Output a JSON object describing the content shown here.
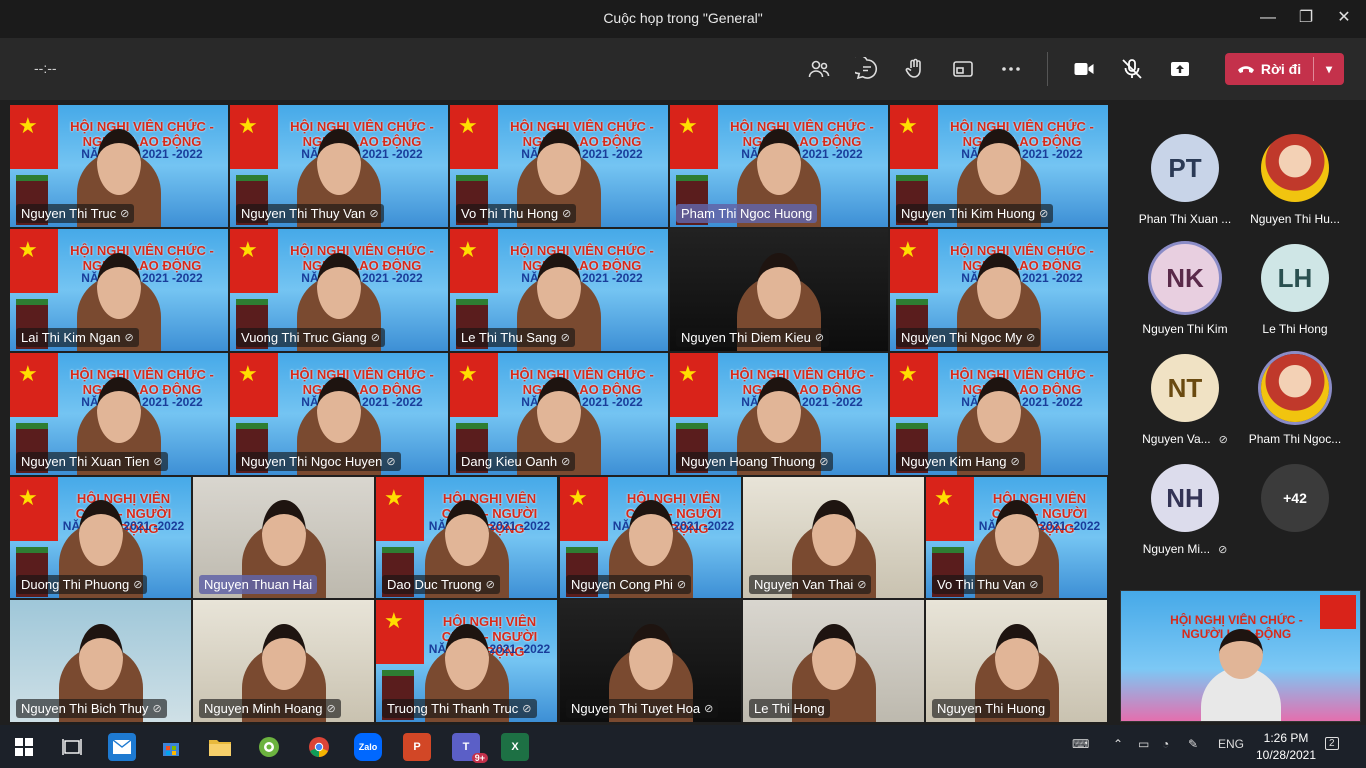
{
  "window": {
    "title": "Cuộc họp trong \"General\"",
    "minimize_icon": "minimize-icon",
    "maximize_icon": "maximize-icon",
    "close_icon": "close-icon"
  },
  "toolbar": {
    "timer": "--:--",
    "icons": [
      "participants-icon",
      "chat-icon",
      "reactions-icon",
      "rooms-icon",
      "more-icon",
      "camera-icon",
      "mic-muted-icon",
      "share-icon"
    ],
    "leave_label": "Rời đi",
    "leave_color": "#c4314b"
  },
  "banner_text": {
    "line1": "HỘI NGHỊ VIÊN CHỨC - NGƯỜI LAO ĐỘNG",
    "line2": "NĂM HỌC 2021 -2022"
  },
  "tiles": [
    {
      "name": "Nguyen Thi Truc",
      "muted": true
    },
    {
      "name": "Nguyen Thi Thuy Van",
      "muted": true
    },
    {
      "name": "Vo Thi Thu Hong",
      "muted": true
    },
    {
      "name": "Pham Thi Ngoc Huong",
      "muted": false,
      "speaking": true
    },
    {
      "name": "Nguyen Thi Kim Huong",
      "muted": true
    },
    {
      "name": "Lai Thi Kim Ngan",
      "muted": true
    },
    {
      "name": "Vuong Thi Truc Giang",
      "muted": true
    },
    {
      "name": "Le Thi Thu Sang",
      "muted": true
    },
    {
      "name": "Nguyen Thi Diem Kieu",
      "muted": true
    },
    {
      "name": "Nguyen Thi Ngoc My",
      "muted": true
    },
    {
      "name": "Nguyen Thi Xuan Tien",
      "muted": true
    },
    {
      "name": "Nguyen Thi Ngoc Huyen",
      "muted": true
    },
    {
      "name": "Dang Kieu Oanh",
      "muted": true
    },
    {
      "name": "Nguyen Hoang Thuong",
      "muted": true
    },
    {
      "name": "Nguyen Kim Hang",
      "muted": true
    },
    {
      "name": "Duong Thi Phuong",
      "muted": true
    },
    {
      "name": "Nguyen Thuan Hai",
      "muted": false,
      "speaking": true
    },
    {
      "name": "Dao Duc Truong",
      "muted": true
    },
    {
      "name": "Nguyen Cong Phi",
      "muted": true
    },
    {
      "name": "Nguyen Van Thai",
      "muted": true
    },
    {
      "name": "Vo Thi Thu Van",
      "muted": true
    },
    {
      "name": "Nguyen Thi Bich Thuy",
      "muted": true
    },
    {
      "name": "Nguyen Minh Hoang",
      "muted": true
    },
    {
      "name": "Truong Thi Thanh Truc",
      "muted": true
    },
    {
      "name": "Nguyen Thi Tuyet Hoa",
      "muted": true
    },
    {
      "name": "Le Thi Hong",
      "muted": false
    },
    {
      "name": "Nguyen Thi Huong",
      "muted": false
    }
  ],
  "sidebar": {
    "participants": [
      {
        "initials": "PT",
        "name": "Phan Thi Xuan ...",
        "muted": false,
        "bg": "#c8d4e8",
        "fg": "#2b3a55"
      },
      {
        "initials": "",
        "name": "Nguyen Thi Hu...",
        "muted": false,
        "photo": true
      },
      {
        "initials": "NK",
        "name": "Nguyen Thi Kim",
        "muted": false,
        "bg": "#e8cfe0",
        "fg": "#5a2a4a",
        "ring": true
      },
      {
        "initials": "LH",
        "name": "Le Thi Hong",
        "muted": false,
        "bg": "#cfe6e6",
        "fg": "#2a5050"
      },
      {
        "initials": "NT",
        "name": "Nguyen Va...",
        "muted": true,
        "bg": "#f0e2c4",
        "fg": "#6a4a10"
      },
      {
        "initials": "",
        "name": "Pham Thi Ngoc...",
        "muted": false,
        "photo": true,
        "ring": true
      },
      {
        "initials": "NH",
        "name": "Nguyen Mi...",
        "muted": true,
        "bg": "#dcdcec",
        "fg": "#333355"
      },
      {
        "initials": "+42",
        "name": "",
        "muted": false,
        "bg": "#3b3b3b",
        "fg": "#ffffff",
        "more": true
      }
    ]
  },
  "taskbar": {
    "apps": [
      "windows-start-icon",
      "task-view-icon",
      "mail-icon",
      "store-icon",
      "file-explorer-icon",
      "coccoc-icon",
      "chrome-icon",
      "zalo-icon",
      "powerpoint-icon",
      "teams-icon",
      "excel-icon"
    ],
    "zalo_label": "Zalo",
    "teams_badge": "9+",
    "language": "ENG",
    "time": "1:26 PM",
    "date": "10/28/2021",
    "notifications": "2"
  }
}
